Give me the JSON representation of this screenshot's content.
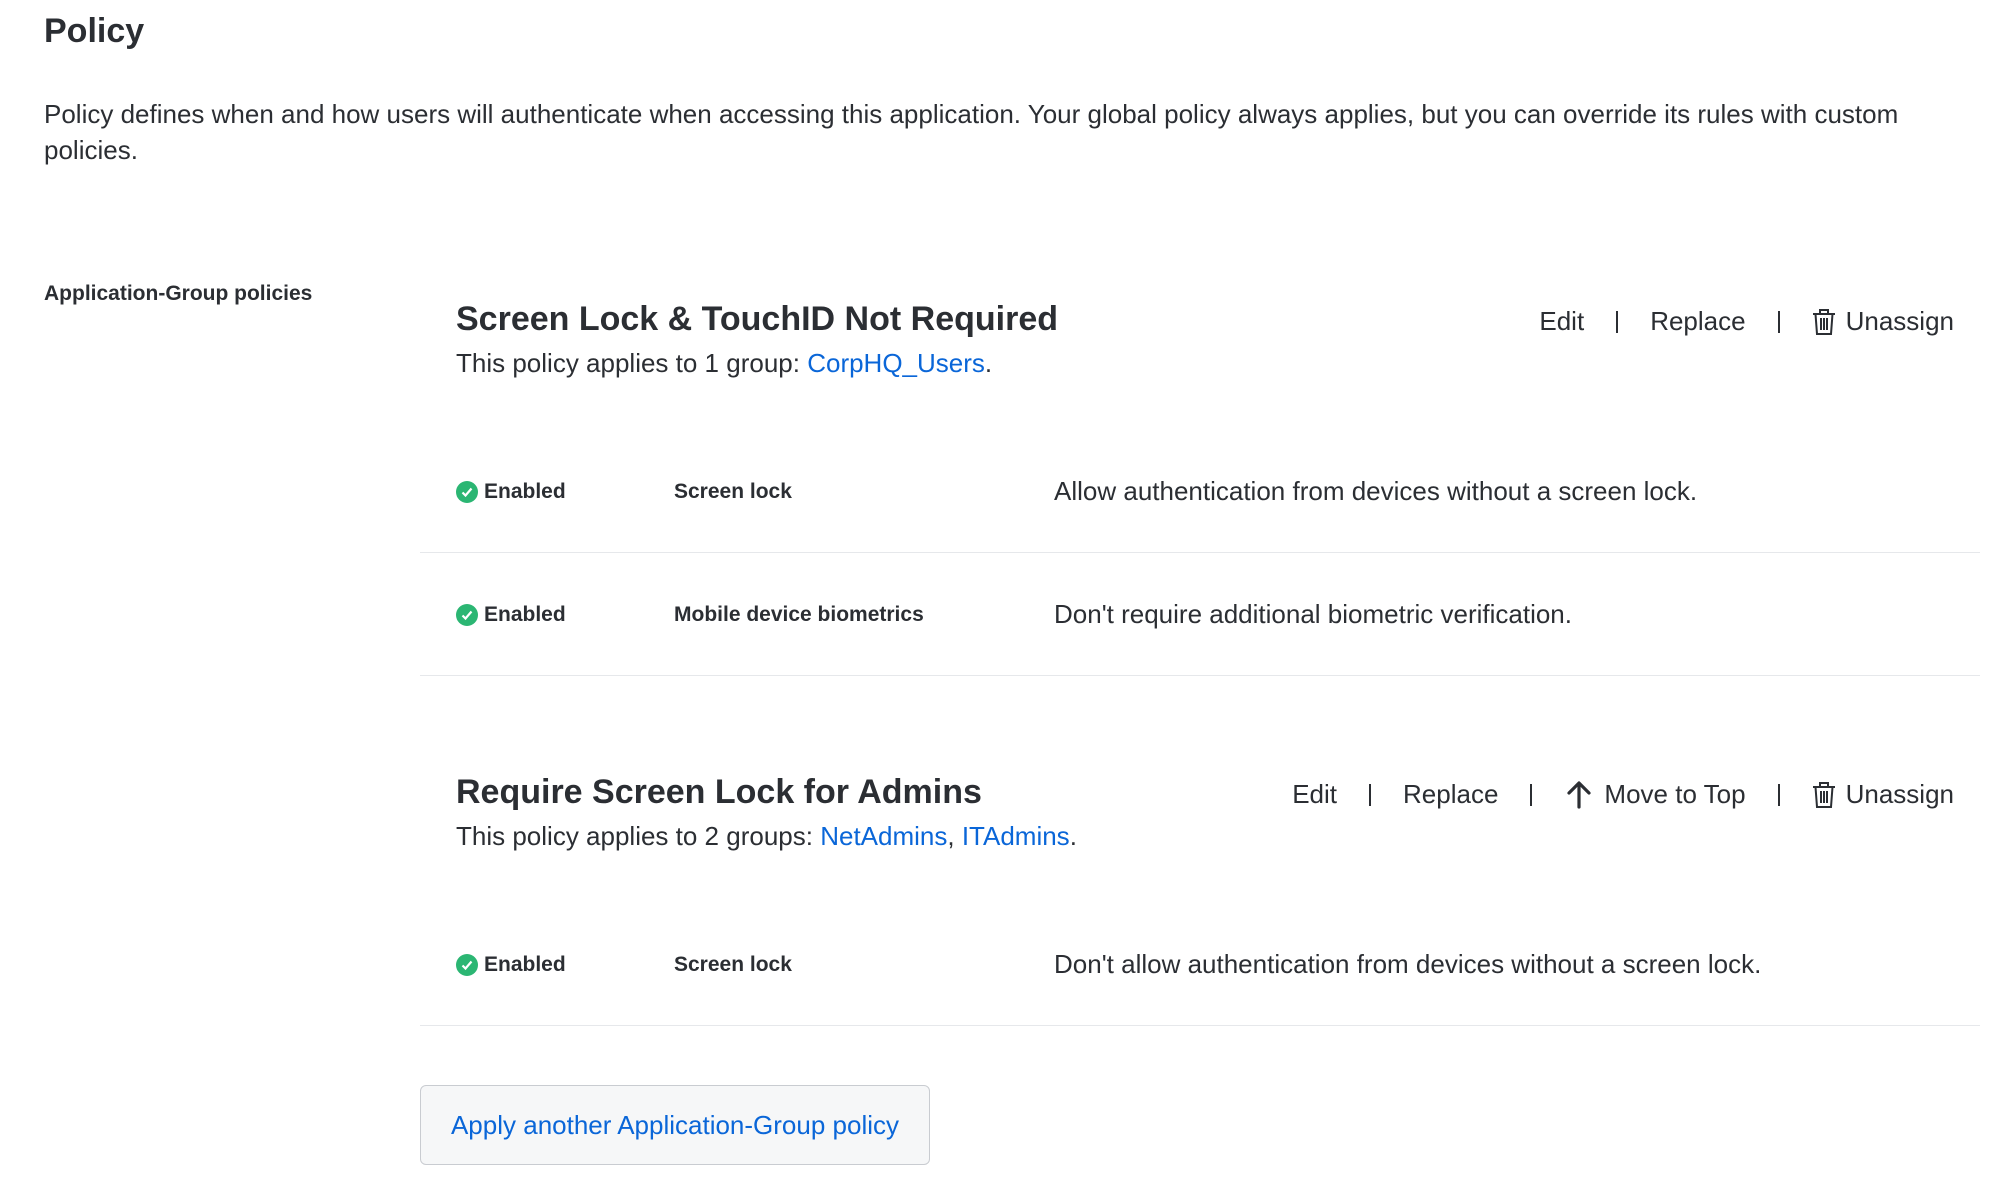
{
  "page": {
    "title": "Policy",
    "intro": "Policy defines when and how users will authenticate when accessing this application. Your global policy always applies, but you can override its rules with custom policies."
  },
  "section": {
    "label": "Application-Group policies"
  },
  "policies": [
    {
      "title": "Screen Lock & TouchID Not Required",
      "applies_prefix": "This policy applies to 1 group: ",
      "groups": [
        "CorpHQ_Users"
      ],
      "applies_suffix": ".",
      "actions": {
        "edit": "Edit",
        "replace": "Replace",
        "unassign": "Unassign"
      },
      "rules": [
        {
          "status": "Enabled",
          "name": "Screen lock",
          "description": "Allow authentication from devices without a screen lock."
        },
        {
          "status": "Enabled",
          "name": "Mobile device biometrics",
          "description": "Don't require additional biometric verification."
        }
      ]
    },
    {
      "title": "Require Screen Lock for Admins",
      "applies_prefix": "This policy applies to 2 groups: ",
      "groups": [
        "NetAdmins",
        "ITAdmins"
      ],
      "group_separator": ", ",
      "applies_suffix": ".",
      "actions": {
        "edit": "Edit",
        "replace": "Replace",
        "move_to_top": "Move to Top",
        "unassign": "Unassign"
      },
      "rules": [
        {
          "status": "Enabled",
          "name": "Screen lock",
          "description": "Don't allow authentication from devices without a screen lock."
        }
      ]
    }
  ],
  "apply_button": {
    "label": "Apply another Application-Group policy"
  },
  "colors": {
    "text": "#2b2e33",
    "link": "#0a66d8",
    "enabled": "#2bb673",
    "divider": "#e6e8eb"
  },
  "icons": {
    "enabled": "check-circle-icon",
    "unassign": "trash-icon",
    "move_to_top": "arrow-up-icon"
  }
}
